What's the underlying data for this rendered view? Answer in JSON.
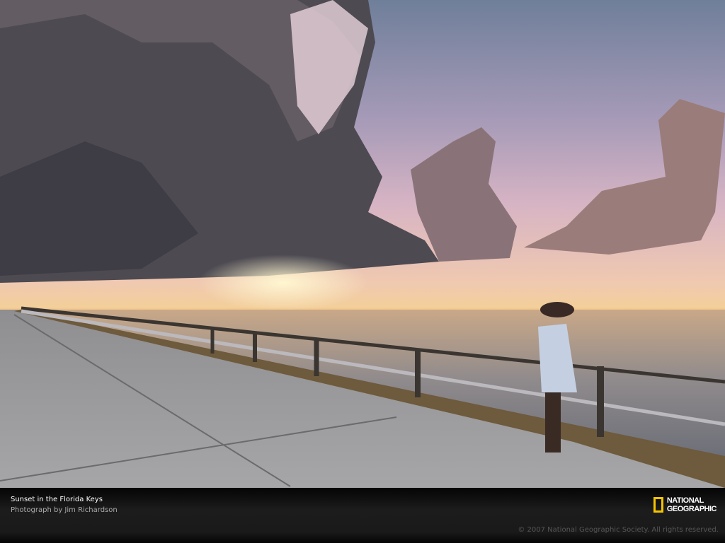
{
  "caption": {
    "title": "Sunset in the Florida Keys",
    "credit": "Photograph by Jim Richardson",
    "copyright": "© 2007 National Geographic Society. All rights reserved."
  },
  "logo": {
    "line1": "NATIONAL",
    "line2": "GEOGRAPHIC",
    "border_color": "#f5c400"
  }
}
